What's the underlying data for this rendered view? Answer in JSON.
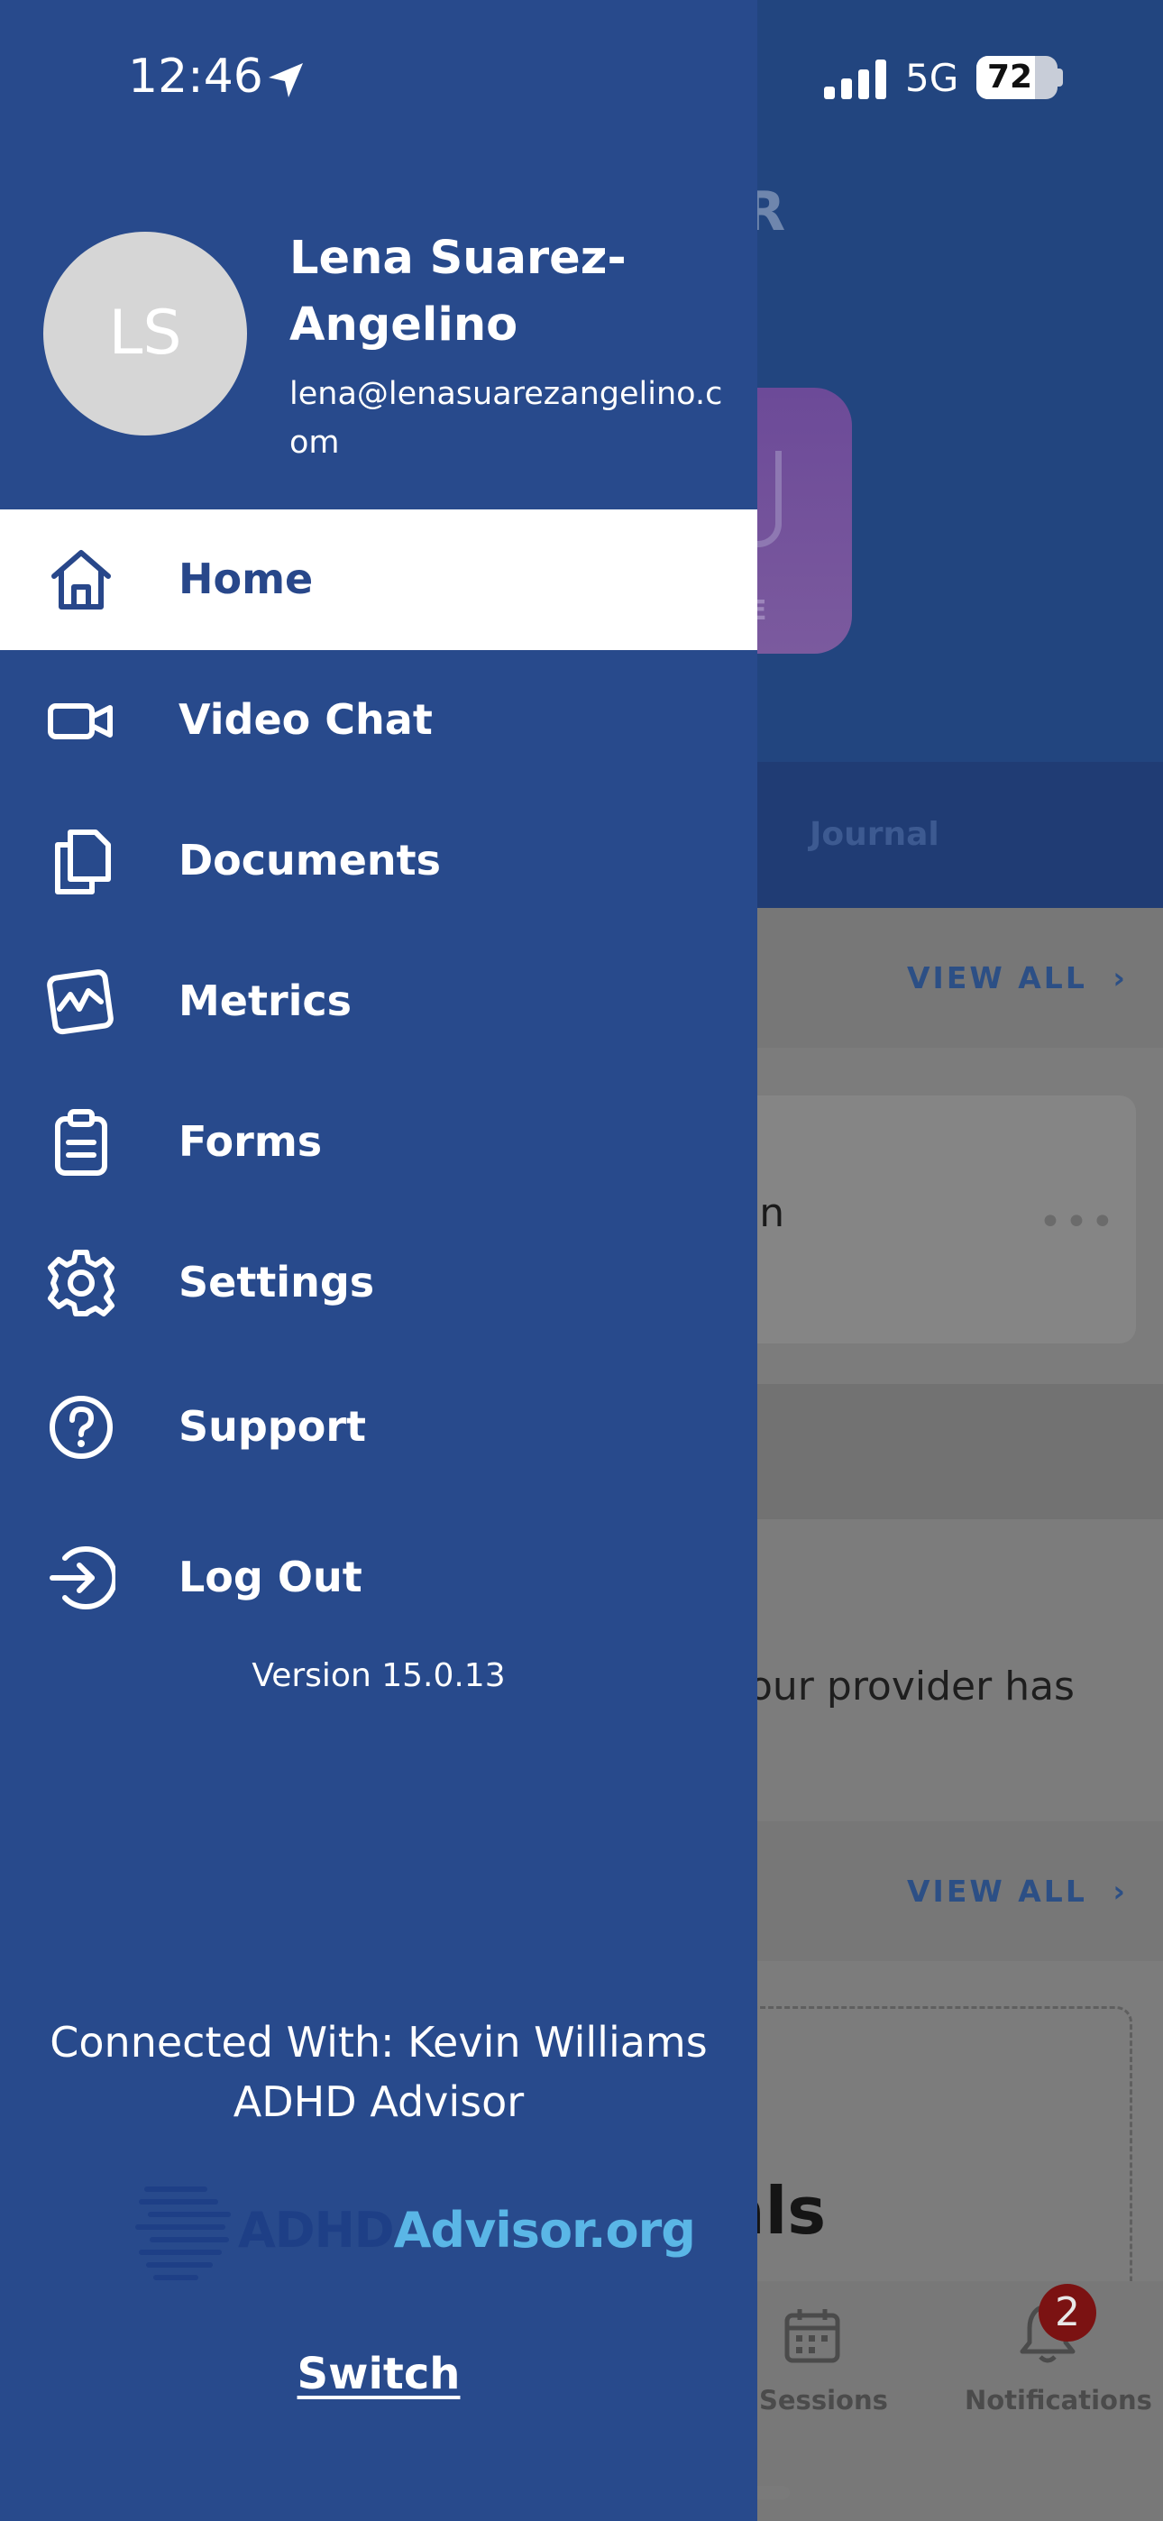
{
  "status_bar": {
    "time": "12:46",
    "network": "5G",
    "battery_level": "72",
    "battery_fraction": 0.72
  },
  "background_app": {
    "header_fragment": "OR",
    "tile_fragment": "E",
    "tab_journal": "Journal",
    "view_all_1": "VIEW ALL",
    "card_text": "in",
    "card_more": "•••",
    "provider_text": "our provider has",
    "view_all_2": "VIEW ALL",
    "goals_fragment": "als",
    "tabbar": {
      "sessions": "Sessions",
      "notifications": "Notifications",
      "notifications_badge": "2"
    }
  },
  "drawer": {
    "avatar_initials": "LS",
    "user_name": "Lena Suarez-Angelino",
    "user_email": "lena@lenasuarezangelino.com",
    "menu": [
      {
        "label": "Home",
        "icon": "home-icon",
        "active": true
      },
      {
        "label": "Video Chat",
        "icon": "video-camera-icon"
      },
      {
        "label": "Documents",
        "icon": "documents-icon"
      },
      {
        "label": "Metrics",
        "icon": "metrics-chart-icon"
      },
      {
        "label": "Forms",
        "icon": "clipboard-icon"
      },
      {
        "label": "Settings",
        "icon": "gear-icon"
      },
      {
        "label": "Support",
        "icon": "question-circle-icon"
      },
      {
        "label": "Log Out",
        "icon": "logout-arrow-icon"
      }
    ],
    "version": "Version 15.0.13",
    "connected_line1": "Connected With: Kevin Williams",
    "connected_line2": "ADHD Advisor",
    "logo": {
      "part1": "ADHD",
      "part2": "Advisor.org"
    },
    "switch_label": "Switch"
  },
  "colors": {
    "drawer_bg": "#284a8c",
    "active_item_bg": "#ffffff",
    "active_item_text": "#28478a",
    "logo_dark": "#1e3f86",
    "logo_light": "#5ab6e6",
    "badge": "#7b1212"
  }
}
